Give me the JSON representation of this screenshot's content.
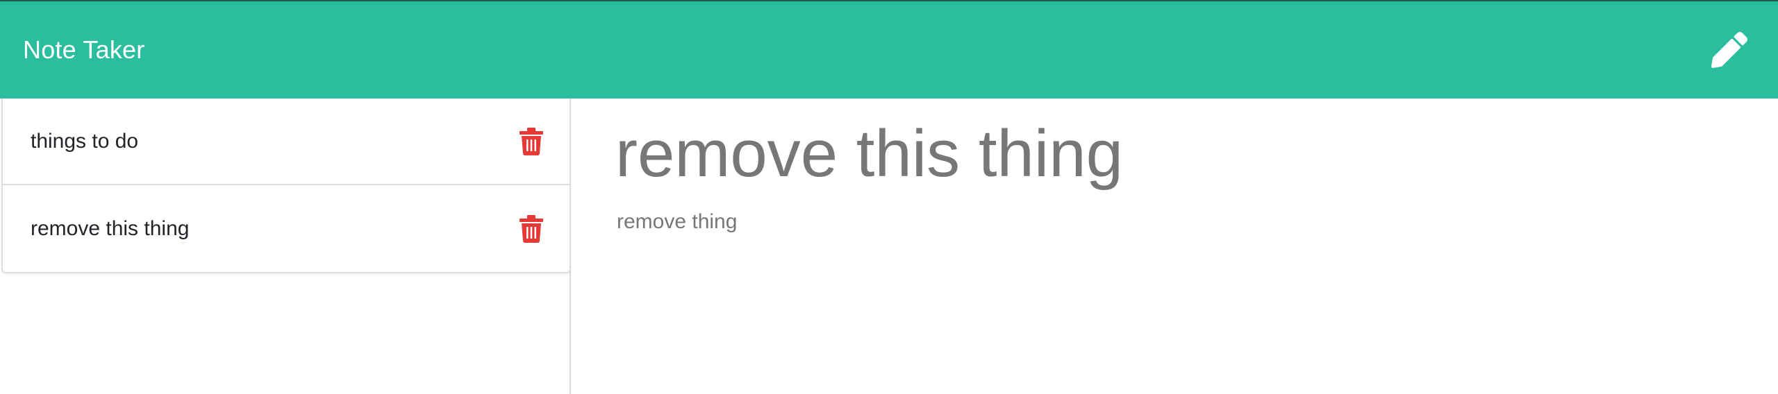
{
  "header": {
    "title": "Note Taker",
    "new_note_icon": "pencil-icon"
  },
  "sidebar": {
    "notes": [
      {
        "title": "things to do",
        "delete_icon": "trash-icon"
      },
      {
        "title": "remove this thing",
        "delete_icon": "trash-icon"
      }
    ]
  },
  "main": {
    "note_title": "remove this thing",
    "note_text": "remove thing"
  },
  "colors": {
    "navbar": "#2abe9f",
    "delete_icon": "#e53935",
    "note_text": "#777777"
  }
}
